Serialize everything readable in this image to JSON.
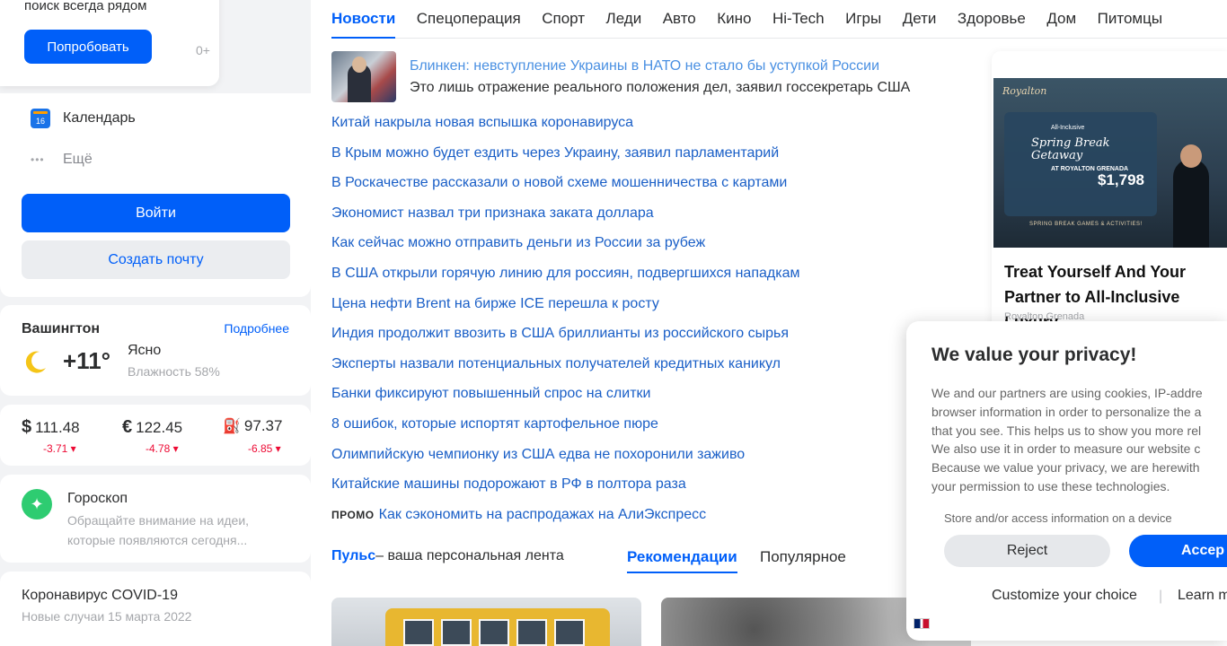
{
  "sidebar": {
    "promo": {
      "text": "поиск всегда рядом",
      "button": "Попробовать",
      "age": "0+"
    },
    "menu": {
      "calendar": "Календарь",
      "calendar_day": "16",
      "more": "Ещё",
      "more_dots": "•••"
    },
    "login_button": "Войти",
    "create_mail_button": "Создать почту",
    "weather": {
      "city": "Вашингтон",
      "more": "Подробнее",
      "temp": "+11°",
      "condition": "Ясно",
      "humidity": "Влажность 58%",
      "icon": "moon-icon"
    },
    "rates": [
      {
        "symbol": "$",
        "value": "111.48",
        "change": "-3.71 ▾",
        "icon": "dollar-icon"
      },
      {
        "symbol": "€",
        "value": "122.45",
        "change": "-4.78 ▾",
        "icon": "euro-icon"
      },
      {
        "symbol": "⛽",
        "value": "97.37",
        "change": "-6.85 ▾",
        "icon": "oil-icon"
      }
    ],
    "horoscope": {
      "title": "Гороскоп",
      "text": "Обращайте внимание на идеи, которые появляются сегодня..."
    },
    "covid": {
      "title": "Коронавирус COVID-19",
      "subtitle": "Новые случаи 15 марта 2022"
    }
  },
  "news": {
    "tabs": [
      "Новости",
      "Спецоперация",
      "Спорт",
      "Леди",
      "Авто",
      "Кино",
      "Hi-Tech",
      "Игры",
      "Дети",
      "Здоровье",
      "Дом",
      "Питомцы"
    ],
    "lead": {
      "title": "Блинкен: невступление Украины в НАТО не стало бы уступкой России",
      "subtitle": "Это лишь отражение реального положения дел, заявил госсекретарь США"
    },
    "items": [
      "Китай накрыла новая вспышка коронавируса",
      "В Крым можно будет ездить через Украину, заявил парламентарий",
      "В Роскачестве рассказали о новой схеме мошенничества с картами",
      "Экономист назвал три признака заката доллара",
      "Как сейчас можно отправить деньги из России за рубеж",
      "В США открыли горячую линию для россиян, подвергшихся нападкам",
      "Цена нефти Brent на бирже ICE перешла к росту",
      "Индия продолжит ввозить в США бриллианты из российского сырья",
      "Эксперты назвали потенциальных получателей кредитных каникул",
      "Банки фиксируют повышенный спрос на слитки",
      "8 ошибок, которые испортят картофельное пюре",
      "Олимпийскую чемпионку из США едва не похоронили заживо",
      "Китайские машины подорожают в РФ в полтора раза"
    ],
    "promo": {
      "tag": "ПРОМО",
      "text": "Как сэкономить на распродажах на АлиЭкспресс"
    }
  },
  "pulse": {
    "link": "Пульс",
    "rest": " – ваша персональная лента",
    "tab_recommend": "Рекомендации",
    "tab_popular": "Популярное"
  },
  "ad": {
    "brand": "Royalton",
    "script_line1": "Spring Break Getaway",
    "small_top": "All-Inclusive",
    "small_sub": "AT ROYALTON GRENADA",
    "price": "$1,798",
    "bottom": "SPRING BREAK GAMES & ACTIVITIES!",
    "title": "Treat Yourself And Your Partner to All-Inclusive Luxury",
    "advertiser": "Royalton Grenada"
  },
  "privacy": {
    "title": "We value your privacy!",
    "lines": [
      "We and our partners are using cookies, IP-addre",
      "browser information in order to personalize the a",
      "that you see. This helps us to show you more rel",
      "We also use it in order to measure our website c",
      "Because we value your privacy, we are herewith",
      "your permission to use these technologies."
    ],
    "cut_line": "Store and/or access information on a device",
    "reject": "Reject",
    "accept": "Accep",
    "customize": "Customize your choice",
    "separator": "|",
    "learn": "Learn m"
  }
}
